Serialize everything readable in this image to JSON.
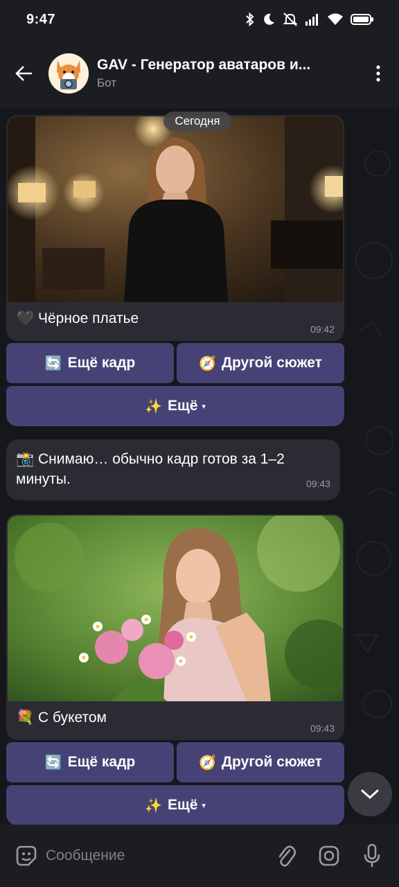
{
  "status_bar": {
    "time": "9:47"
  },
  "header": {
    "title": "GAV - Генератор аватаров и...",
    "subtitle": "Бот"
  },
  "chat": {
    "date_label": "Сегодня",
    "messages": [
      {
        "type": "photo",
        "caption_emoji": "🖤",
        "caption": "Чёрное платье",
        "time": "09:42",
        "buttons": {
          "more_shot": {
            "emoji": "🔄",
            "label": "Ещё кадр"
          },
          "other_plot": {
            "emoji": "🧭",
            "label": "Другой сюжет"
          },
          "more": {
            "emoji": "✨",
            "label": "Ещё",
            "caret": "▾"
          }
        }
      },
      {
        "type": "text",
        "emoji": "📸",
        "text": "Снимаю… обычно кадр готов за 1–2 минуты.",
        "time": "09:43"
      },
      {
        "type": "photo",
        "caption_emoji": "💐",
        "caption": "С букетом",
        "time": "09:43",
        "buttons": {
          "more_shot": {
            "emoji": "🔄",
            "label": "Ещё кадр"
          },
          "other_plot": {
            "emoji": "🧭",
            "label": "Другой сюжет"
          },
          "more": {
            "emoji": "✨",
            "label": "Ещё",
            "caret": "▾"
          }
        }
      }
    ]
  },
  "composer": {
    "placeholder": "Сообщение"
  },
  "colors": {
    "keyboard_button": "#474276",
    "bubble": "#2b2c33",
    "bar": "#1c1d21"
  }
}
